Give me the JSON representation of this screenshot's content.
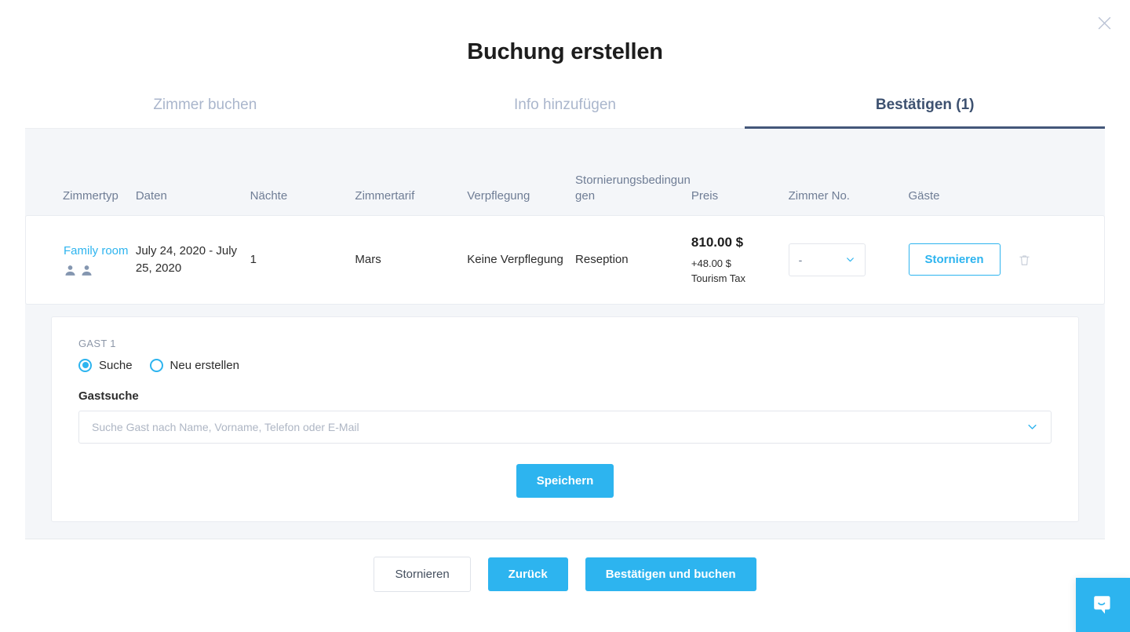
{
  "modal": {
    "title": "Buchung erstellen",
    "close_icon": "close-icon"
  },
  "tabs": [
    {
      "label": "Zimmer buchen",
      "active": false
    },
    {
      "label": "Info hinzufügen",
      "active": false
    },
    {
      "label": "Bestätigen (1)",
      "active": true
    }
  ],
  "table": {
    "headers": [
      "Zimmertyp",
      "Daten",
      "Nächte",
      "Zimmertarif",
      "Verpflegung",
      "Stornierungsbedingungen",
      "Preis",
      "Zimmer No.",
      "Gäste"
    ],
    "rows": [
      {
        "room_type": "Family room",
        "guest_icon_count": 2,
        "dates": "July 24, 2020 - July 25, 2020",
        "nights": "1",
        "rate": "Mars",
        "board": "Keine Verpflegung",
        "cancellation": "Reseption",
        "price": "810.00 $",
        "price_extra": "+48.00 $",
        "price_extra_label": "Tourism Tax",
        "room_no": "-",
        "guest_action": "Stornieren",
        "delete_icon": "trash-icon"
      }
    ]
  },
  "guest_section": {
    "gast_label": "GAST 1",
    "options": [
      {
        "label": "Suche",
        "selected": true
      },
      {
        "label": "Neu erstellen",
        "selected": false
      }
    ],
    "search_label": "Gastsuche",
    "search_value": "",
    "search_placeholder": "Suche Gast nach Name, Vorname, Telefon oder E-Mail",
    "save_label": "Speichern"
  },
  "footer": {
    "cancel_label": "Stornieren",
    "back_label": "Zurück",
    "confirm_label": "Bestätigen und buchen"
  },
  "widget": {
    "name": "intercom-chat-icon"
  },
  "colors": {
    "accent_blue": "#2db4ef",
    "tab_active": "#3d5170",
    "tab_inactive": "#aab6cc",
    "content_bg": "#f4f6f9"
  }
}
